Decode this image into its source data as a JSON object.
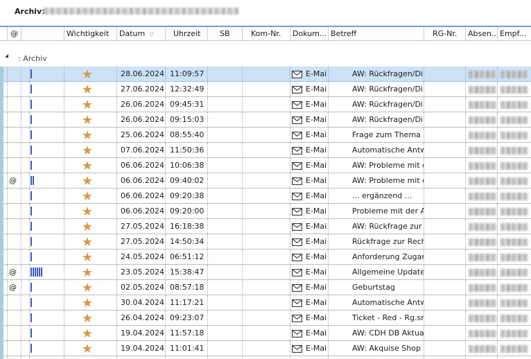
{
  "title": {
    "label": "Archiv:"
  },
  "columns": {
    "at": "@",
    "wichtigkeit": "Wichtigkeit",
    "datum": "Datum",
    "uhrzeit": "Uhrzeit",
    "sb": "SB",
    "komnr": "Kom-Nr.",
    "dokument": "Dokum...",
    "betreff": "Betreff",
    "rgnr": "RG-Nr.",
    "absender": "Absen...",
    "empf": "Empf..."
  },
  "group": {
    "label": ": Archiv"
  },
  "colors": {
    "selected_row": "#cde2f7",
    "header_accent": "#6f9fd0",
    "priority_bar": "#3b57c7",
    "star": "#d69a45"
  },
  "rows": [
    {
      "at": "",
      "priority": 1,
      "datum": "28.06.2024",
      "uhrzeit": "11:09:57",
      "dok": "E-Mai",
      "betreff": "AW: Rückfragen/Di",
      "selected": true
    },
    {
      "at": "",
      "priority": 1,
      "datum": "27.06.2024",
      "uhrzeit": "12:32:49",
      "dok": "E-Mai",
      "betreff": "AW: Rückfragen/Di"
    },
    {
      "at": "",
      "priority": 1,
      "datum": "26.06.2024",
      "uhrzeit": "09:45:31",
      "dok": "E-Mai",
      "betreff": "AW: Rückfragen/Di"
    },
    {
      "at": "",
      "priority": 1,
      "datum": "26.06.2024",
      "uhrzeit": "09:15:03",
      "dok": "E-Mai",
      "betreff": "AW: Rückfragen/Di"
    },
    {
      "at": "",
      "priority": 1,
      "datum": "25.06.2024",
      "uhrzeit": "08:55:40",
      "dok": "E-Mai",
      "betreff": "Frage zum Thema #"
    },
    {
      "at": "",
      "priority": 1,
      "datum": "07.06.2024",
      "uhrzeit": "11:50:36",
      "dok": "E-Mai",
      "betreff": "Automatische Antw"
    },
    {
      "at": "",
      "priority": 1,
      "datum": "06.06.2024",
      "uhrzeit": "10:06:38",
      "dok": "E-Mai",
      "betreff": "AW: Probleme mit c"
    },
    {
      "at": "@",
      "priority": 2,
      "datum": "06.06.2024",
      "uhrzeit": "09:40:02",
      "dok": "E-Mai",
      "betreff": "AW: Probleme mit c"
    },
    {
      "at": "",
      "priority": 1,
      "datum": "06.06.2024",
      "uhrzeit": "09:20:38",
      "dok": "E-Mai",
      "betreff": "... ergänzend ..."
    },
    {
      "at": "",
      "priority": 1,
      "datum": "06.06.2024",
      "uhrzeit": "09:20:00",
      "dok": "E-Mai",
      "betreff": "Probleme mit der A"
    },
    {
      "at": "",
      "priority": 1,
      "datum": "27.05.2024",
      "uhrzeit": "16:18:38",
      "dok": "E-Mai",
      "betreff": "AW: Rückfrage zur l"
    },
    {
      "at": "",
      "priority": 1,
      "datum": "27.05.2024",
      "uhrzeit": "14:50:34",
      "dok": "E-Mai",
      "betreff": "Rückfrage zur Rech"
    },
    {
      "at": "",
      "priority": 1,
      "datum": "24.05.2024",
      "uhrzeit": "06:51:12",
      "dok": "E-Mai",
      "betreff": "Anforderung Zugar"
    },
    {
      "at": "@",
      "priority": 6,
      "datum": "23.05.2024",
      "uhrzeit": "15:38:47",
      "dok": "E-Mai",
      "betreff": "Allgemeine Update"
    },
    {
      "at": "@",
      "priority": 1,
      "datum": "02.05.2024",
      "uhrzeit": "08:57:18",
      "dok": "E-Mai",
      "betreff": "Geburtstag"
    },
    {
      "at": "",
      "priority": 1,
      "datum": "30.04.2024",
      "uhrzeit": "11:17:21",
      "dok": "E-Mai",
      "betreff": "Automatische Antw"
    },
    {
      "at": "",
      "priority": 1,
      "datum": "26.04.2024",
      "uhrzeit": "09:23:07",
      "dok": "E-Mai",
      "betreff": "Ticket - Red - Rg.sn"
    },
    {
      "at": "",
      "priority": 1,
      "datum": "19.04.2024",
      "uhrzeit": "11:57:18",
      "dok": "E-Mai",
      "betreff": "AW: CDH DB Aktua"
    },
    {
      "at": "",
      "priority": 1,
      "datum": "19.04.2024",
      "uhrzeit": "11:01:41",
      "dok": "E-Mai",
      "betreff": "AW: Akquise Shop"
    },
    {
      "at": "",
      "priority": 1,
      "datum": "",
      "uhrzeit": "",
      "dok": "",
      "betreff": ""
    }
  ]
}
